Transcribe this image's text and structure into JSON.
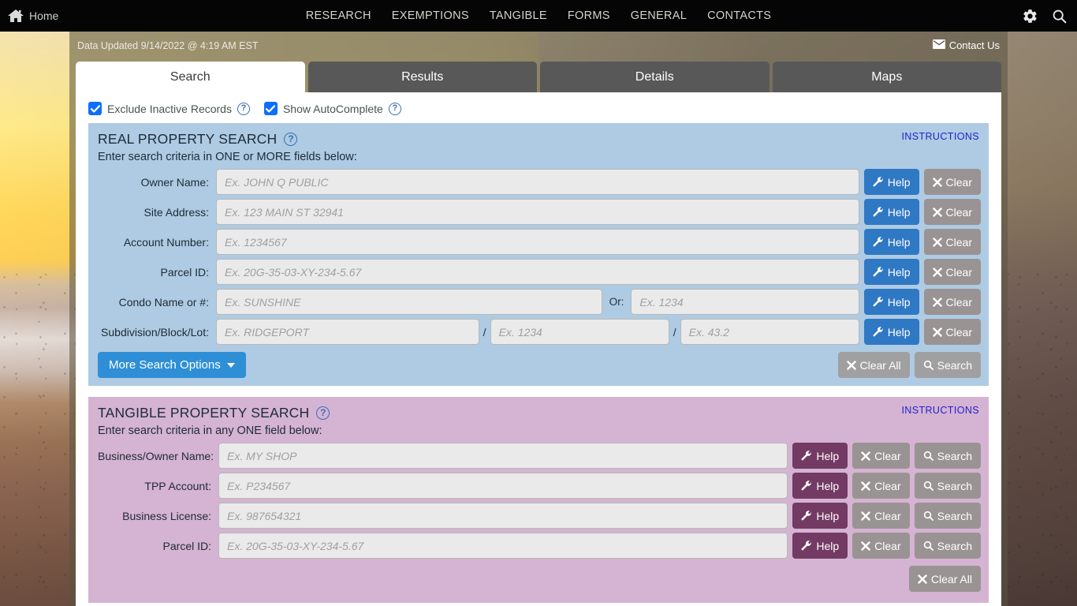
{
  "topnav": {
    "home_label": "Home",
    "menu": [
      "RESEARCH",
      "EXEMPTIONS",
      "TANGIBLE",
      "FORMS",
      "GENERAL",
      "CONTACTS"
    ],
    "icons": [
      "gear-icon",
      "search-icon"
    ]
  },
  "header": {
    "updated_text": "Data Updated 9/14/2022 @ 4:19 AM EST",
    "contact_us": "Contact Us"
  },
  "tabs": [
    {
      "label": "Search",
      "active": true
    },
    {
      "label": "Results",
      "active": false
    },
    {
      "label": "Details",
      "active": false
    },
    {
      "label": "Maps",
      "active": false
    }
  ],
  "options": [
    {
      "label": "Exclude Inactive Records",
      "checked": true
    },
    {
      "label": "Show AutoComplete",
      "checked": true
    }
  ],
  "real_property": {
    "title": "REAL PROPERTY SEARCH",
    "subtitle": "Enter search criteria in ONE or MORE fields below:",
    "instructions": "INSTRUCTIONS",
    "accent": "#aecbe3",
    "help_button_color": "#2f78c4",
    "fields": [
      {
        "label": "Owner Name:",
        "placeholder": "Ex. JOHN Q PUBLIC",
        "value": ""
      },
      {
        "label": "Site Address:",
        "placeholder": "Ex. 123 MAIN ST 32941",
        "value": ""
      },
      {
        "label": "Account Number:",
        "placeholder": "Ex. 1234567",
        "value": ""
      },
      {
        "label": "Parcel ID:",
        "placeholder": "Ex. 20G-35-03-XY-234-5.67",
        "value": ""
      }
    ],
    "condo": {
      "label": "Condo Name or #:",
      "placeholder": "Ex. SUNSHINE",
      "or_label": "Or:",
      "placeholder2": "Ex. 1234"
    },
    "subdivision": {
      "label": "Subdivision/Block/Lot:",
      "placeholder": "Ex. RIDGEPORT",
      "sep1": "/",
      "placeholder2": "Ex. 1234",
      "sep2": "/",
      "placeholder3": "Ex. 43.2"
    },
    "help_label": "Help",
    "clear_label": "Clear",
    "more_options_label": "More Search Options",
    "clear_all_label": "Clear All",
    "search_label": "Search"
  },
  "tangible_property": {
    "title": "TANGIBLE PROPERTY SEARCH",
    "subtitle": "Enter search criteria in any ONE field below:",
    "instructions": "INSTRUCTIONS",
    "accent": "#d5b3d2",
    "help_button_color": "#733a63",
    "fields": [
      {
        "label": "Business/Owner Name:",
        "placeholder": "Ex. MY SHOP",
        "value": ""
      },
      {
        "label": "TPP Account:",
        "placeholder": "Ex. P234567",
        "value": ""
      },
      {
        "label": "Business License:",
        "placeholder": "Ex. 987654321",
        "value": ""
      },
      {
        "label": "Parcel ID:",
        "placeholder": "Ex. 20G-35-03-XY-234-5.67",
        "value": ""
      }
    ],
    "help_label": "Help",
    "clear_label": "Clear",
    "search_label": "Search",
    "clear_all_label": "Clear All"
  }
}
